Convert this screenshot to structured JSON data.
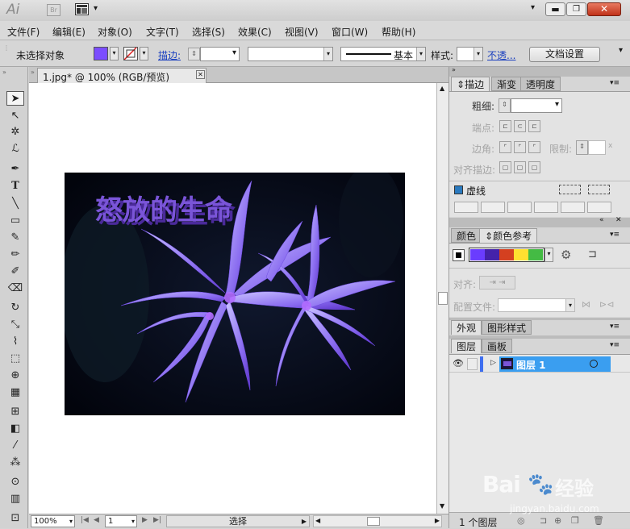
{
  "app": {
    "logo": "Ai",
    "br_badge": "Br"
  },
  "menu": [
    "文件(F)",
    "编辑(E)",
    "对象(O)",
    "文字(T)",
    "选择(S)",
    "效果(C)",
    "视图(V)",
    "窗口(W)",
    "帮助(H)"
  ],
  "control_bar": {
    "selection_label": "未选择对象",
    "stroke_label": "描边:",
    "stroke_profile": "基本",
    "style_label": "样式:",
    "opacity_link": "不透...",
    "doc_settings_button": "文档设置",
    "fill_color": "#7b4dff"
  },
  "document": {
    "tab_title": "1.jpg* @ 100% (RGB/预览)",
    "image_text": "怒放的生命",
    "image_text_color": "#7a55d8"
  },
  "status": {
    "zoom": "100%",
    "artboard": "1",
    "tool_label": "选择"
  },
  "panels": {
    "stroke_group": {
      "tabs": [
        "描边",
        "渐变",
        "透明度"
      ],
      "weight_label": "粗细:",
      "cap_label": "端点:",
      "corner_label": "边角:",
      "limit_label": "限制:",
      "limit_x": "x",
      "align_label": "对齐描边:",
      "dashed_label": "虚线"
    },
    "color_group": {
      "tabs": [
        "颜色",
        "颜色参考"
      ],
      "harmony_colors": [
        "#6a3cff",
        "#4422aa",
        "#d44020",
        "#ffe030",
        "#44bb44",
        "#e05a2a"
      ],
      "align_label": "对齐:",
      "profile_label": "配置文件:"
    },
    "appearance_group": {
      "tabs": [
        "外观",
        "图形样式"
      ]
    },
    "layers_group": {
      "tabs": [
        "图层",
        "画板"
      ],
      "layers": [
        {
          "name": "图层 1"
        }
      ],
      "footer_count": "1 个图层"
    }
  },
  "watermark": {
    "brand": "Bai",
    "brand_tail": "经验",
    "url": "jingyan.baidu.com"
  }
}
